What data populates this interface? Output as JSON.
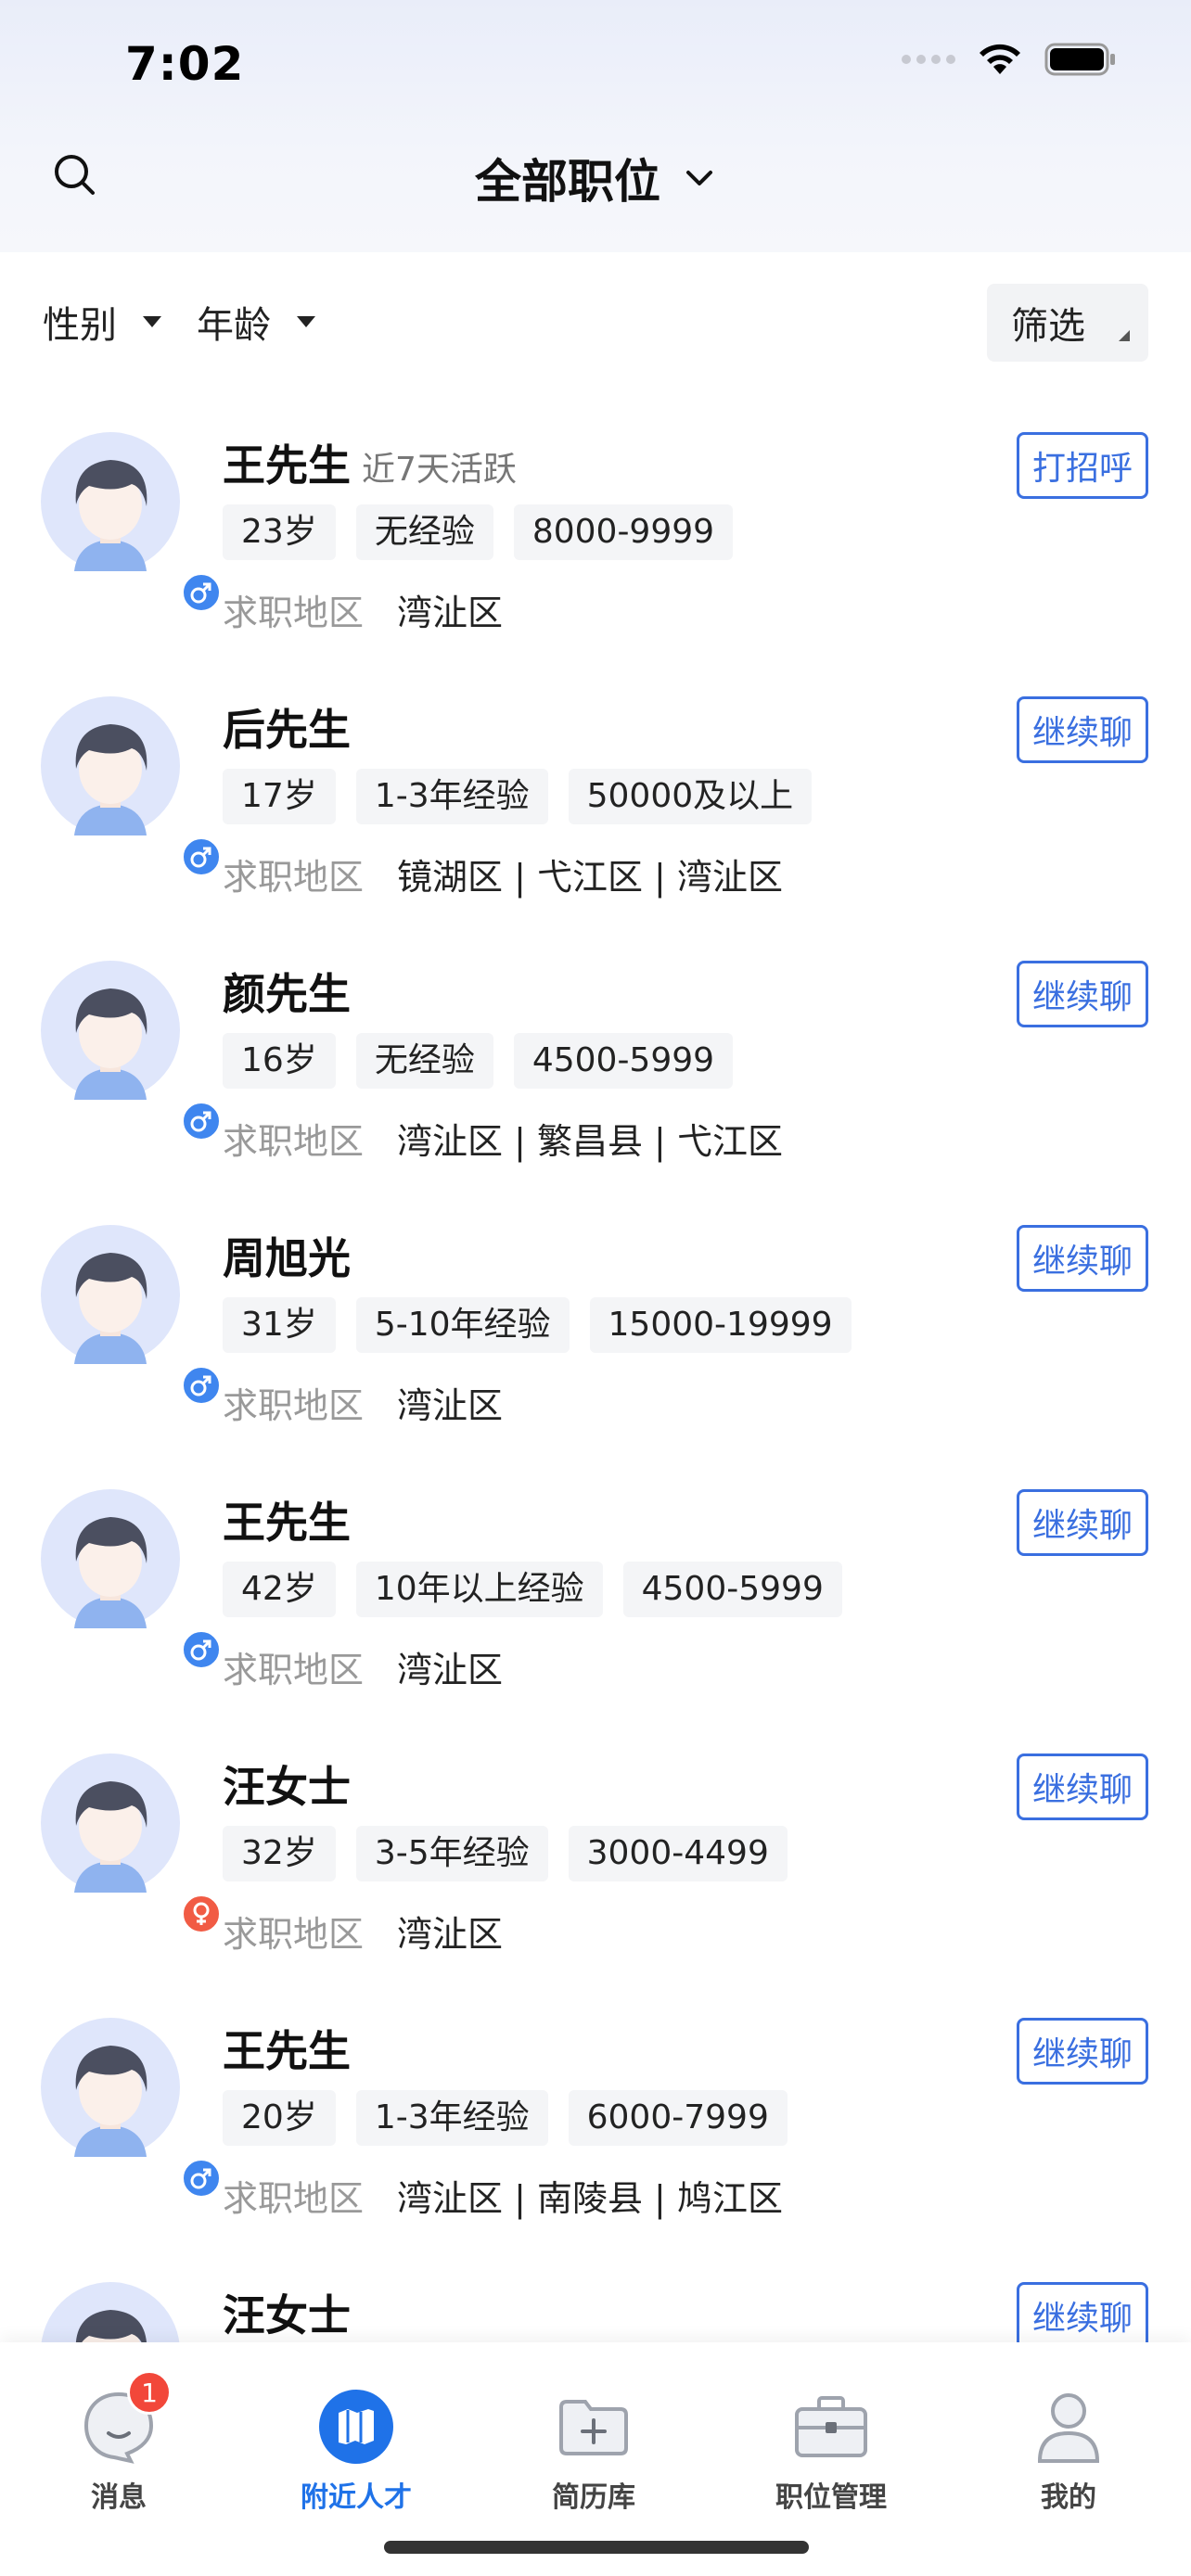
{
  "status_bar": {
    "time": "7:02"
  },
  "header": {
    "title": "全部职位"
  },
  "filters": {
    "gender_label": "性别",
    "age_label": "年龄",
    "filter_button_label": "筛选"
  },
  "region_label": "求职地区",
  "candidates": [
    {
      "name": "王先生",
      "active": "近7天活跃",
      "gender": "male",
      "age": "23岁",
      "experience": "无经验",
      "salary": "8000-9999",
      "region": "湾沚区",
      "action": "打招呼"
    },
    {
      "name": "后先生",
      "active": "",
      "gender": "male",
      "age": "17岁",
      "experience": "1-3年经验",
      "salary": "50000及以上",
      "region": "镜湖区 | 弋江区 | 湾沚区",
      "action": "继续聊"
    },
    {
      "name": "颜先生",
      "active": "",
      "gender": "male",
      "age": "16岁",
      "experience": "无经验",
      "salary": "4500-5999",
      "region": "湾沚区 | 繁昌县 | 弋江区",
      "action": "继续聊"
    },
    {
      "name": "周旭光",
      "active": "",
      "gender": "male",
      "age": "31岁",
      "experience": "5-10年经验",
      "salary": "15000-19999",
      "region": "湾沚区",
      "action": "继续聊"
    },
    {
      "name": "王先生",
      "active": "",
      "gender": "male",
      "age": "42岁",
      "experience": "10年以上经验",
      "salary": "4500-5999",
      "region": "湾沚区",
      "action": "继续聊"
    },
    {
      "name": "汪女士",
      "active": "",
      "gender": "female",
      "age": "32岁",
      "experience": "3-5年经验",
      "salary": "3000-4499",
      "region": "湾沚区",
      "action": "继续聊"
    },
    {
      "name": "王先生",
      "active": "",
      "gender": "male",
      "age": "20岁",
      "experience": "1-3年经验",
      "salary": "6000-7999",
      "region": "湾沚区 | 南陵县 | 鸠江区",
      "action": "继续聊"
    },
    {
      "name": "汪女士",
      "active": "",
      "gender": "female",
      "age": "",
      "experience": "",
      "salary": "",
      "region": "",
      "action": "继续聊"
    }
  ],
  "tabbar": {
    "items": [
      {
        "label": "消息",
        "icon": "message-icon",
        "badge": "1"
      },
      {
        "label": "附近人才",
        "icon": "map-icon"
      },
      {
        "label": "简历库",
        "icon": "folder-add-icon"
      },
      {
        "label": "职位管理",
        "icon": "briefcase-icon"
      },
      {
        "label": "我的",
        "icon": "user-icon"
      }
    ],
    "active_index": 1
  },
  "colors": {
    "accent": "#1f72e8",
    "button_border": "#3a6fe0",
    "male": "#3f86ef",
    "female": "#f15b44",
    "badge": "#f2473a"
  }
}
